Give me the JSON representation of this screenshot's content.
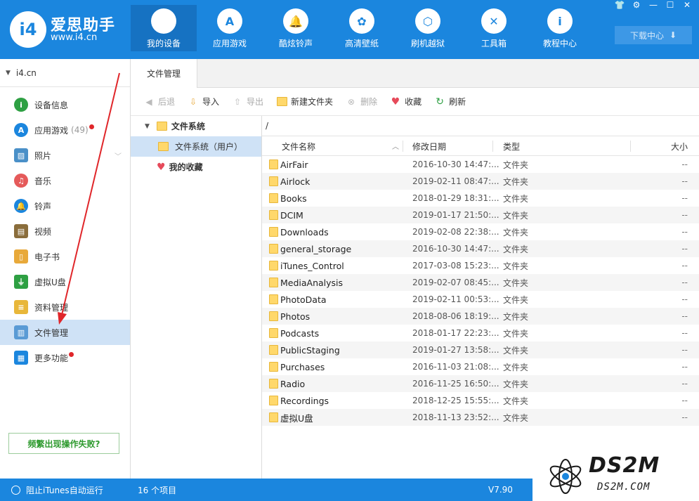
{
  "app": {
    "brand_name": "爱思助手",
    "brand_url": "www.i4.cn",
    "logo_text": "i4"
  },
  "nav": [
    {
      "label": "我的设备",
      "icon": "apple-icon",
      "glyph": "",
      "active": true
    },
    {
      "label": "应用游戏",
      "icon": "app-store-icon",
      "glyph": "A"
    },
    {
      "label": "酷炫铃声",
      "icon": "bell-icon",
      "glyph": "🔔"
    },
    {
      "label": "高清壁纸",
      "icon": "flower-icon",
      "glyph": "✿"
    },
    {
      "label": "刷机越狱",
      "icon": "box-icon",
      "glyph": "⬡"
    },
    {
      "label": "工具箱",
      "icon": "tools-icon",
      "glyph": "✕"
    },
    {
      "label": "教程中心",
      "icon": "info-icon",
      "glyph": "i"
    }
  ],
  "window_controls": [
    "👕",
    "⚙",
    "—",
    "☐",
    "✕"
  ],
  "download_center": {
    "label": "下载中心",
    "icon": "download-icon"
  },
  "sidebar": {
    "device": "i4.cn",
    "items": [
      {
        "label": "设备信息",
        "icon": "info-icon",
        "color": "#2ea043",
        "glyph": "i"
      },
      {
        "label": "应用游戏",
        "icon": "app-store-icon",
        "color": "#1b86de",
        "glyph": "A",
        "count": "(49)",
        "dot": true
      },
      {
        "label": "照片",
        "icon": "photo-icon",
        "color": "#4a90c8",
        "glyph": "▨",
        "square": true,
        "expand": true
      },
      {
        "label": "音乐",
        "icon": "music-icon",
        "color": "#e55a5a",
        "glyph": "♫"
      },
      {
        "label": "铃声",
        "icon": "bell-icon",
        "color": "#1b86de",
        "glyph": "🔔"
      },
      {
        "label": "视频",
        "icon": "video-icon",
        "color": "#8a6d3b",
        "glyph": "▤",
        "square": true
      },
      {
        "label": "电子书",
        "icon": "book-icon",
        "color": "#e8a93a",
        "glyph": "▯",
        "square": true
      },
      {
        "label": "虚拟U盘",
        "icon": "usb-icon",
        "color": "#2ea043",
        "glyph": "⏚",
        "square": true
      },
      {
        "label": "资料管理",
        "icon": "document-icon",
        "color": "#e8b73a",
        "glyph": "≡",
        "square": true
      },
      {
        "label": "文件管理",
        "icon": "file-manager-icon",
        "color": "#5a9bd5",
        "glyph": "▥",
        "square": true,
        "active": true
      },
      {
        "label": "更多功能",
        "icon": "grid-icon",
        "color": "#1b86de",
        "glyph": "▦",
        "square": true,
        "dot": true
      }
    ],
    "help_button": "频繁出现操作失败?"
  },
  "tab": {
    "label": "文件管理"
  },
  "toolbar": {
    "back": "后退",
    "import": "导入",
    "export": "导出",
    "new_folder": "新建文件夹",
    "delete": "删除",
    "favorite": "收藏",
    "refresh": "刷新"
  },
  "tree": {
    "root": "文件系统",
    "child": "文件系统（用户）",
    "favorites": "我的收藏"
  },
  "path": "/",
  "table": {
    "headers": {
      "name": "文件名称",
      "date": "修改日期",
      "type": "类型",
      "size": "大小"
    },
    "rows": [
      {
        "name": "AirFair",
        "date": "2016-10-30 14:47:...",
        "type": "文件夹",
        "size": "--"
      },
      {
        "name": "Airlock",
        "date": "2019-02-11 08:47:...",
        "type": "文件夹",
        "size": "--"
      },
      {
        "name": "Books",
        "date": "2018-01-29 18:31:...",
        "type": "文件夹",
        "size": "--"
      },
      {
        "name": "DCIM",
        "date": "2019-01-17 21:50:...",
        "type": "文件夹",
        "size": "--"
      },
      {
        "name": "Downloads",
        "date": "2019-02-08 22:38:...",
        "type": "文件夹",
        "size": "--"
      },
      {
        "name": "general_storage",
        "date": "2016-10-30 14:47:...",
        "type": "文件夹",
        "size": "--"
      },
      {
        "name": "iTunes_Control",
        "date": "2017-03-08 15:23:...",
        "type": "文件夹",
        "size": "--"
      },
      {
        "name": "MediaAnalysis",
        "date": "2019-02-07 08:45:...",
        "type": "文件夹",
        "size": "--"
      },
      {
        "name": "PhotoData",
        "date": "2019-02-11 00:53:...",
        "type": "文件夹",
        "size": "--"
      },
      {
        "name": "Photos",
        "date": "2018-08-06 18:19:...",
        "type": "文件夹",
        "size": "--"
      },
      {
        "name": "Podcasts",
        "date": "2018-01-17 22:23:...",
        "type": "文件夹",
        "size": "--"
      },
      {
        "name": "PublicStaging",
        "date": "2019-01-27 13:58:...",
        "type": "文件夹",
        "size": "--"
      },
      {
        "name": "Purchases",
        "date": "2016-11-03 21:08:...",
        "type": "文件夹",
        "size": "--"
      },
      {
        "name": "Radio",
        "date": "2016-11-25 16:50:...",
        "type": "文件夹",
        "size": "--"
      },
      {
        "name": "Recordings",
        "date": "2018-12-25 15:55:...",
        "type": "文件夹",
        "size": "--"
      },
      {
        "name": "虚拟U盘",
        "date": "2018-11-13 23:52:...",
        "type": "文件夹",
        "size": "--"
      }
    ]
  },
  "status": {
    "itunes_option": "阻止iTunes自动运行",
    "item_count": "16 个项目",
    "version": "V7.90"
  },
  "watermark": {
    "main": "DS2M",
    "sub": "DS2M.COM"
  },
  "colors": {
    "primary": "#1b86de",
    "selected": "#cfe2f6",
    "annotation": "#e0262a"
  }
}
